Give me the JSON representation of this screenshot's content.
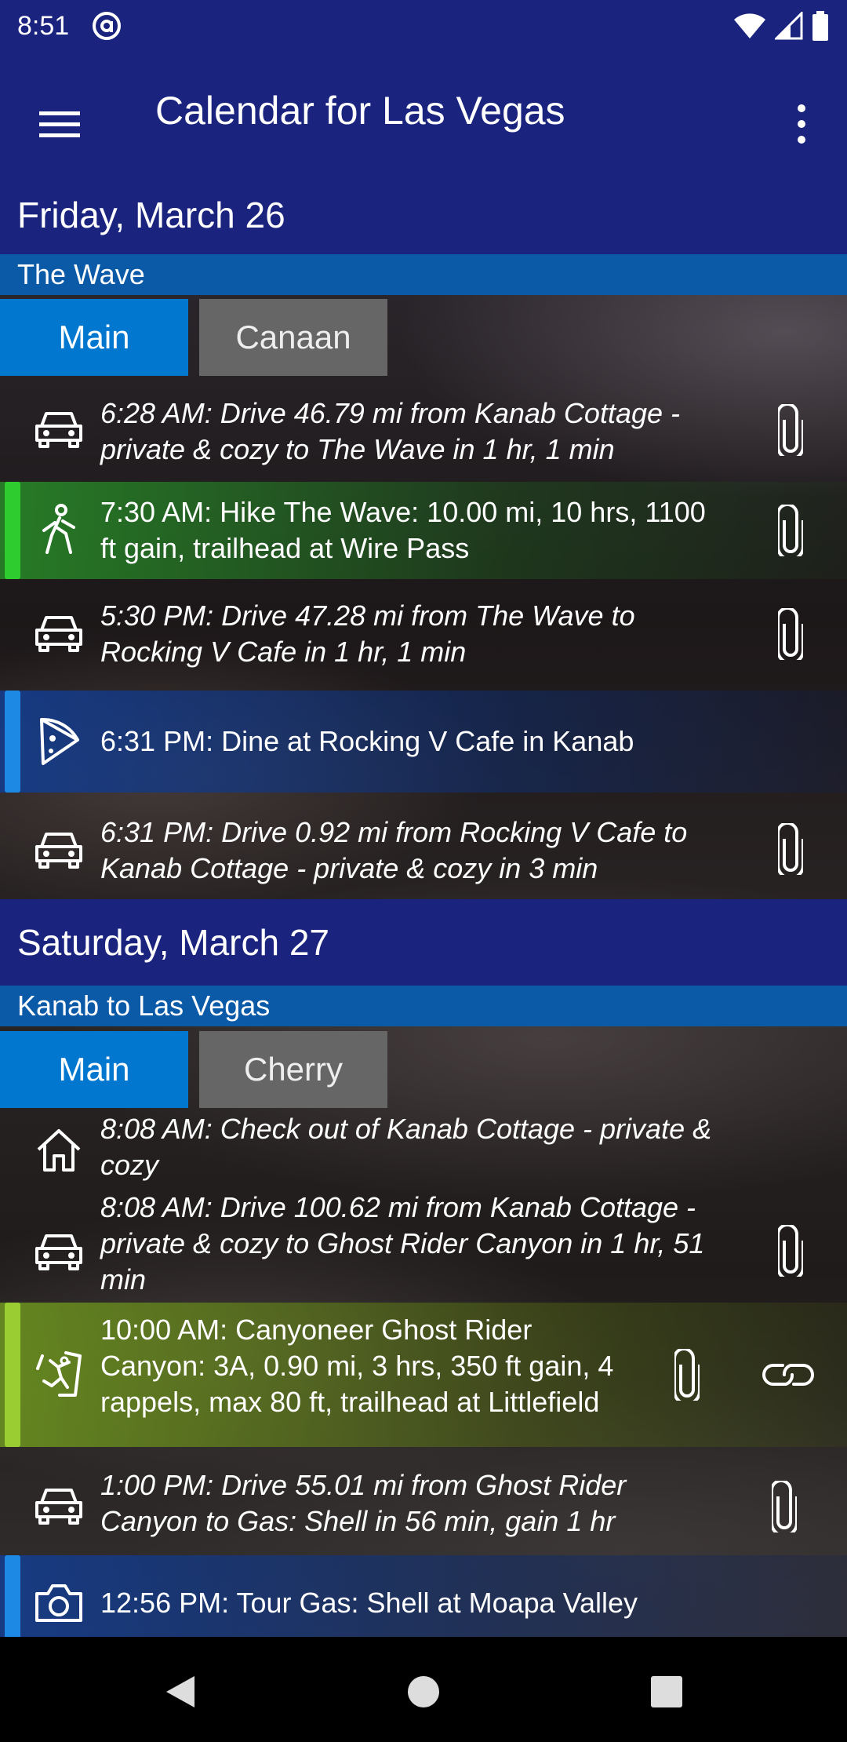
{
  "status": {
    "time": "8:51"
  },
  "appbar": {
    "title": "Calendar for Las Vegas"
  },
  "day1": {
    "header": "Friday, March 26",
    "trip": "The Wave",
    "tabs": [
      "Main",
      "Canaan"
    ],
    "events": [
      {
        "text": "6:28 AM: Drive 46.79 mi from Kanab Cottage - private & cozy to The Wave in 1 hr, 1 min",
        "icon": "car-icon"
      },
      {
        "text": "7:30 AM: Hike The Wave: 10.00 mi, 10 hrs, 1100 ft gain, trailhead at Wire Pass",
        "icon": "hiker-icon",
        "accent": "#2ecc2e"
      },
      {
        "text": "5:30 PM: Drive 47.28 mi from The Wave to Rocking V Cafe in 1 hr, 1 min",
        "icon": "car-icon"
      },
      {
        "text": "6:31 PM: Dine at Rocking V Cafe in Kanab",
        "icon": "pizza-icon",
        "accent": "#1e88e5"
      },
      {
        "text": "6:31 PM: Drive 0.92 mi from Rocking V Cafe to Kanab Cottage - private & cozy in 3 min",
        "icon": "car-icon"
      }
    ]
  },
  "day2": {
    "header": "Saturday, March 27",
    "trip": "Kanab to Las Vegas",
    "tabs": [
      "Main",
      "Cherry"
    ],
    "events": [
      {
        "text": "8:08 AM: Check out of Kanab Cottage - private & cozy",
        "icon": "home-icon"
      },
      {
        "text": "8:08 AM: Drive 100.62 mi from Kanab Cottage - private & cozy to Ghost Rider Canyon in 1 hr, 51 min",
        "icon": "car-icon"
      },
      {
        "text": "10:00 AM: Canyoneer Ghost Rider Canyon: 3A, 0.90 mi, 3 hrs, 350 ft gain, 4 rappels, max 80 ft, trailhead at Littlefield",
        "icon": "climber-icon",
        "accent": "#9acd32"
      },
      {
        "text": "1:00 PM: Drive 55.01 mi from Ghost Rider Canyon to Gas: Shell in 56 min, gain 1 hr",
        "icon": "car-icon"
      },
      {
        "text": "12:56 PM: Tour Gas: Shell at Moapa Valley",
        "icon": "camera-icon",
        "accent": "#1e88e5"
      }
    ]
  },
  "colors": {
    "primary": "#1a237e",
    "tab_active": "#0277d0",
    "tab_inactive": "#666666",
    "trip_bar": "#0b5aa8"
  }
}
